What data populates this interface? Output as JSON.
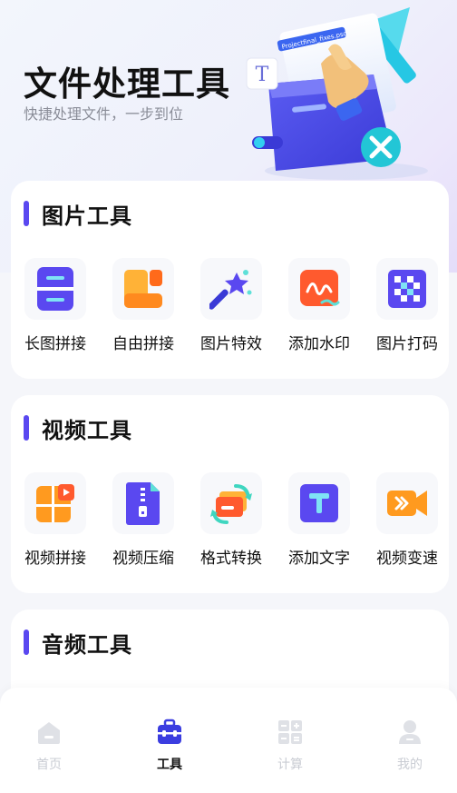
{
  "header": {
    "title": "文件处理工具",
    "subtitle": "快捷处理文件，一步到位",
    "illustration": {
      "file_label": "Projectfinal_fixes.psd",
      "t_badge": "T"
    }
  },
  "sections": [
    {
      "title": "图片工具",
      "items": [
        {
          "label": "长图拼接",
          "icon": "long-image-stitch-icon"
        },
        {
          "label": "自由拼接",
          "icon": "free-stitch-icon"
        },
        {
          "label": "图片特效",
          "icon": "magic-wand-icon"
        },
        {
          "label": "添加水印",
          "icon": "watermark-icon"
        },
        {
          "label": "图片打码",
          "icon": "mosaic-icon"
        }
      ]
    },
    {
      "title": "视频工具",
      "items": [
        {
          "label": "视频拼接",
          "icon": "video-stitch-icon"
        },
        {
          "label": "视频压缩",
          "icon": "zip-file-icon"
        },
        {
          "label": "格式转换",
          "icon": "format-convert-icon"
        },
        {
          "label": "添加文字",
          "icon": "text-icon"
        },
        {
          "label": "视频变速",
          "icon": "video-speed-icon"
        }
      ]
    },
    {
      "title": "音频工具",
      "items": []
    }
  ],
  "tabbar": {
    "active": "工具",
    "tabs": [
      {
        "label": "首页",
        "icon": "home-icon"
      },
      {
        "label": "工具",
        "icon": "toolbox-icon"
      },
      {
        "label": "计算",
        "icon": "grid-icon"
      },
      {
        "label": "我的",
        "icon": "user-icon"
      }
    ]
  },
  "colors": {
    "accent": "#5a48f0",
    "orange": "#ff8a1f",
    "tab_inactive": "#c9ccd3"
  }
}
